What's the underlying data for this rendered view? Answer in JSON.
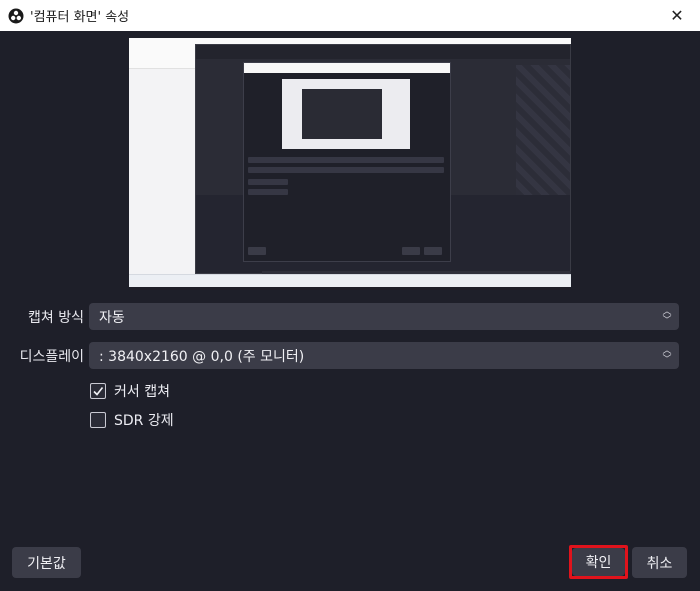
{
  "window": {
    "title": "'컴퓨터 화면' 속성",
    "close_glyph": "✕",
    "app_icon": "obs-logo-icon"
  },
  "preview": {
    "description_icon": "screen-capture-preview"
  },
  "form": {
    "capture_method_label": "캡쳐 방식",
    "capture_method_value": "자동",
    "display_label": "디스플레이",
    "display_value": ": 3840x2160 @ 0,0 (주 모니터)",
    "capture_cursor_label": "커서 캡쳐",
    "capture_cursor_checked": true,
    "sdr_force_label": "SDR 강제",
    "sdr_force_checked": false
  },
  "buttons": {
    "defaults_label": "기본값",
    "ok_label": "확인",
    "cancel_label": "취소"
  },
  "colors": {
    "background": "#1e1f29",
    "control": "#3b3c48",
    "highlight": "#e0131c"
  }
}
